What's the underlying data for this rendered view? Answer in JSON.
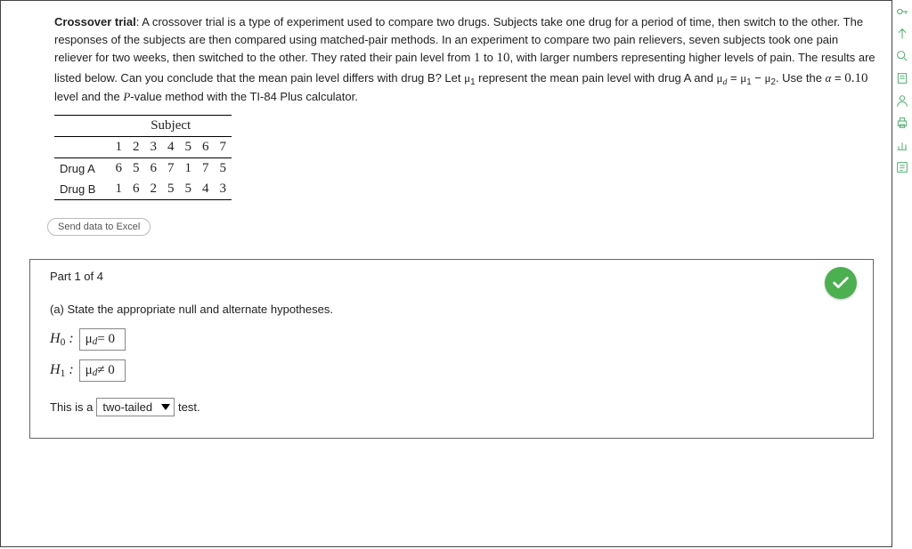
{
  "problem": {
    "bold_lead": "Crossover trial",
    "text_before_nums": ": A crossover trial is a type of experiment used to compare two drugs. Subjects take one drug for a period of time, then switch to the other. The responses of the subjects are then compared using matched-pair methods. In an experiment to compare two pain relievers, seven subjects took one pain reliever for two weeks, then switched to the other. They rated their pain level from ",
    "range_lo": "1",
    "range_mid": " to ",
    "range_hi": "10",
    "text_after_range": ", with larger numbers representing higher levels of pain. The results are listed below. Can you conclude that the mean pain level differs with drug B? Let ",
    "mu1": "μ",
    "mu1_sub": "1",
    "text_mu1": " represent the mean pain level with drug A and ",
    "mud": "μ",
    "mud_sub": "d",
    "eq": " = ",
    "mu1b": "μ",
    "mu1b_sub": "1",
    "minus": " − ",
    "mu2": "μ",
    "mu2_sub": "2",
    "text_alpha": ". Use the ",
    "alpha": "α",
    "alpha_eq": " = ",
    "alpha_val": "0.10",
    "text_end": " level and the ",
    "pvalue": "P",
    "text_pvalue_rest": "-value method with the TI-84 Plus calculator."
  },
  "table": {
    "subject_label": "Subject",
    "col_heads": [
      "1",
      "2",
      "3",
      "4",
      "5",
      "6",
      "7"
    ],
    "rows": [
      {
        "label": "Drug A",
        "values": [
          "6",
          "5",
          "6",
          "7",
          "1",
          "7",
          "5"
        ]
      },
      {
        "label": "Drug B",
        "values": [
          "1",
          "6",
          "2",
          "5",
          "5",
          "4",
          "3"
        ]
      }
    ]
  },
  "excel_btn": "Send data to Excel",
  "part": {
    "title": "Part 1 of 4",
    "question": "(a) State the appropriate null and alternate hypotheses.",
    "h0_label": "H",
    "h0_sub": "0",
    "h1_label": "H",
    "h1_sub": "1",
    "colon": " : ",
    "h0_content_sym": "μ",
    "h0_content_sub": "d",
    "h0_content_rest": " = 0",
    "h1_content_sym": "μ",
    "h1_content_sub": "d",
    "h1_content_rest": " ≠ 0",
    "tail_before": "This is a ",
    "tail_selected": "two-tailed",
    "tail_after": " test."
  }
}
